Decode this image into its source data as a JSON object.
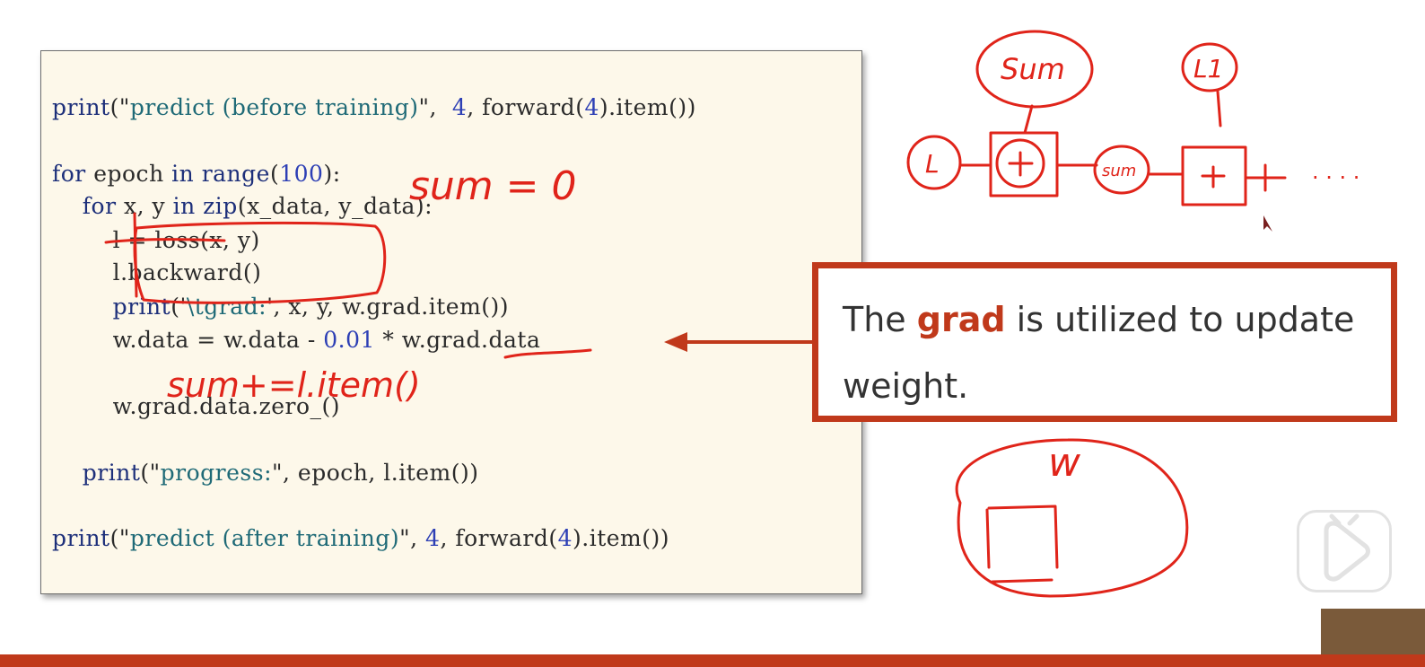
{
  "code": {
    "lines": [
      {
        "segments": [
          {
            "t": "print",
            "c": "kw"
          },
          {
            "t": "(\"",
            "c": ""
          },
          {
            "t": "predict (before training)",
            "c": "str"
          },
          {
            "t": "\",  ",
            "c": ""
          },
          {
            "t": "4",
            "c": "num"
          },
          {
            "t": ", forward(",
            "c": ""
          },
          {
            "t": "4",
            "c": "num"
          },
          {
            "t": ").item())",
            "c": ""
          }
        ]
      },
      {
        "segments": [
          {
            "t": "for",
            "c": "kw"
          },
          {
            "t": " epoch ",
            "c": ""
          },
          {
            "t": "in",
            "c": "kw"
          },
          {
            "t": " ",
            "c": ""
          },
          {
            "t": "range",
            "c": "kw"
          },
          {
            "t": "(",
            "c": ""
          },
          {
            "t": "100",
            "c": "num"
          },
          {
            "t": "):",
            "c": ""
          }
        ]
      },
      {
        "segments": [
          {
            "t": "    ",
            "c": ""
          },
          {
            "t": "for",
            "c": "kw"
          },
          {
            "t": " x, y ",
            "c": ""
          },
          {
            "t": "in",
            "c": "kw"
          },
          {
            "t": " ",
            "c": ""
          },
          {
            "t": "zip",
            "c": "kw"
          },
          {
            "t": "(x_data, y_data):",
            "c": ""
          }
        ]
      },
      {
        "segments": [
          {
            "t": "        l = loss(x, y)",
            "c": ""
          }
        ]
      },
      {
        "segments": [
          {
            "t": "        l.backward()",
            "c": ""
          }
        ]
      },
      {
        "segments": [
          {
            "t": "        ",
            "c": ""
          },
          {
            "t": "print",
            "c": "kw"
          },
          {
            "t": "('",
            "c": ""
          },
          {
            "t": "\\tgrad:",
            "c": "str"
          },
          {
            "t": "', x, y, w.grad.item())",
            "c": ""
          }
        ]
      },
      {
        "segments": [
          {
            "t": "        w.data = w.data - ",
            "c": ""
          },
          {
            "t": "0.01",
            "c": "num"
          },
          {
            "t": " * w.grad.data",
            "c": ""
          }
        ]
      },
      {
        "segments": [
          {
            "t": "        w.grad.data.zero_()",
            "c": ""
          }
        ]
      },
      {
        "segments": [
          {
            "t": "    ",
            "c": ""
          },
          {
            "t": "print",
            "c": "kw"
          },
          {
            "t": "(\"",
            "c": ""
          },
          {
            "t": "progress:",
            "c": "str"
          },
          {
            "t": "\", epoch, l.item())",
            "c": ""
          }
        ]
      },
      {
        "segments": [
          {
            "t": "print",
            "c": "kw"
          },
          {
            "t": "(\"",
            "c": ""
          },
          {
            "t": "predict (after training)",
            "c": "str"
          },
          {
            "t": "\", ",
            "c": ""
          },
          {
            "t": "4",
            "c": "num"
          },
          {
            "t": ", forward(",
            "c": ""
          },
          {
            "t": "4",
            "c": "num"
          },
          {
            "t": ").item())",
            "c": ""
          }
        ]
      }
    ]
  },
  "callout": {
    "before": "The ",
    "highlight": "grad",
    "after": " is utilized to update weight."
  },
  "annotations": {
    "sum_init": "sum = 0",
    "sum_update": "sum+=l.item()",
    "node_sum_top": "Sum",
    "node_l1": "L1",
    "node_l": "L",
    "node_plus": "+",
    "node_sum_mid": "sum",
    "ellipsis": "· · · ·",
    "weight_label": "w"
  },
  "colors": {
    "accent": "#c0391b",
    "ink": "#e0241a",
    "code_bg": "#fdf8ea"
  }
}
